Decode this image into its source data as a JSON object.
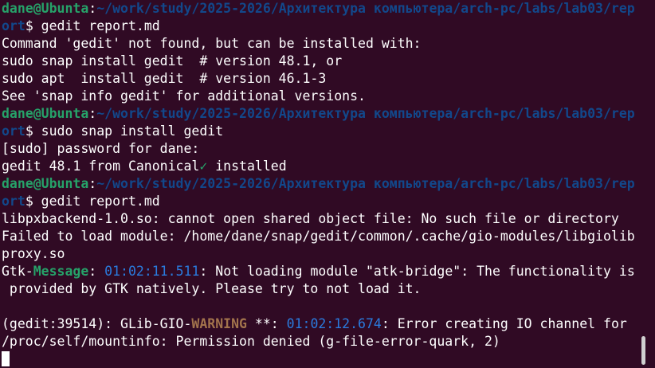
{
  "terminal": {
    "colors": {
      "background": "#300a24",
      "text": "#ffffff",
      "user_host": "#26a269",
      "path": "#12488b",
      "timestamp": "#2a7bde",
      "warning": "#a2734c"
    },
    "prompt": {
      "user_host": "dane@Ubunta",
      "sep": ":",
      "path_1": "~/work/study/2025-2026/Архитектура компьютера/arch-pc/labs/lab03/rep",
      "path_2": "ort",
      "dollar": "$"
    },
    "commands": [
      " gedit report.md",
      " sudo snap install gedit",
      " gedit report.md"
    ],
    "output": {
      "not_found": "Command 'gedit' not found, but can be installed with:",
      "snap_option": "sudo snap install gedit  # version 48.1, or",
      "apt_option": "sudo apt  install gedit  # version 46.1-3",
      "see_info": "See 'snap info gedit' for additional versions.",
      "sudo_prompt": "[sudo] password for dane:",
      "installed_pre": "gedit 48.1 from Canonical",
      "check_mark": "✓",
      "installed_post": " installed",
      "libpx_error": "libpxbackend-1.0.so: cannot open shared object file: No such file or directory",
      "failed_1": "Failed to load module: /home/dane/snap/gedit/common/.cache/gio-modules/libgiolib",
      "failed_2": "proxy.so",
      "gtk_prefix": "Gtk-",
      "gtk_message": "Message",
      "gtk_sep": ": ",
      "gtk_time": "01:02:11.511",
      "gtk_text_1": ": Not loading module \"atk-bridge\": The functionality is",
      "gtk_text_2": " provided by GTK natively. Please try to not load it.",
      "glib_prefix": "(gedit:39514): GLib-GIO-",
      "glib_warning": "WARNING",
      "glib_stars": " **: ",
      "glib_time": "01:02:12.674",
      "glib_text_1": ": Error creating IO channel for",
      "glib_text_2": "/proc/self/mountinfo: Permission denied (g-file-error-quark, 2)"
    }
  }
}
